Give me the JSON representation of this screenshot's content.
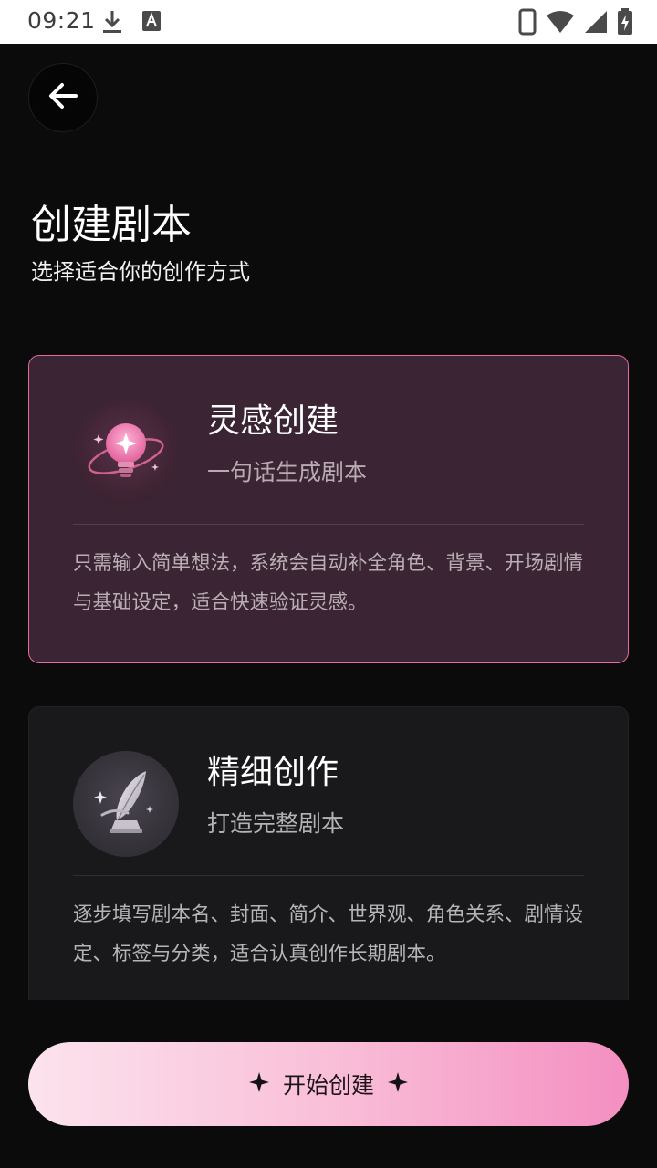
{
  "status_bar": {
    "time": "09:21"
  },
  "header": {
    "title": "创建剧本",
    "subtitle": "选择适合你的创作方式"
  },
  "options": [
    {
      "title": "灵感创建",
      "tagline": "一句话生成剧本",
      "description": "只需输入简单想法，系统会自动补全角色、背景、开场剧情与基础设定，适合快速验证灵感。",
      "icon": "lightbulb-sparkle-icon",
      "selected": true
    },
    {
      "title": "精细创作",
      "tagline": "打造完整剧本",
      "description": "逐步填写剧本名、封面、简介、世界观、角色关系、剧情设定、标签与分类，适合认真创作长期剧本。",
      "icon": "quill-pen-icon",
      "selected": false
    }
  ],
  "start_button": {
    "label": "开始创建"
  },
  "colors": {
    "accent": "#e46aa0",
    "selected_card_bg": "#3b2433",
    "card_bg": "#19191b",
    "page_bg": "#0b0b0c",
    "button_gradient_start": "#fce3ee",
    "button_gradient_end": "#f48fc1"
  }
}
